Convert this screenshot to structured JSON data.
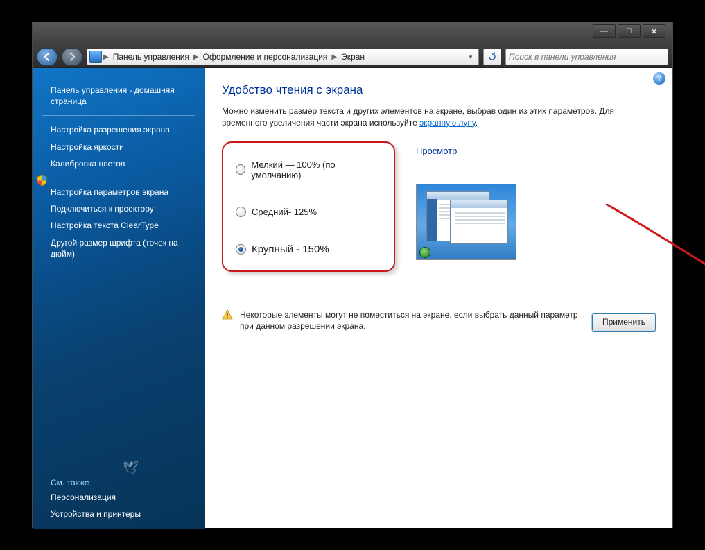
{
  "window": {
    "min": "—",
    "max": "□",
    "close": "✕"
  },
  "nav": {
    "breadcrumb": [
      "Панель управления",
      "Оформление и персонализация",
      "Экран"
    ],
    "search_placeholder": "Поиск в панели управления"
  },
  "sidebar": {
    "home": "Панель управления - домашняя страница",
    "items": [
      "Настройка разрешения экрана",
      "Настройка яркости",
      "Калибровка цветов",
      "Настройка параметров экрана",
      "Подключиться к проектору",
      "Настройка текста ClearType",
      "Другой размер шрифта (точек на дюйм)"
    ],
    "shield_index": 2,
    "see_also_title": "См. также",
    "see_also": [
      "Персонализация",
      "Устройства и принтеры"
    ]
  },
  "page": {
    "title": "Удобство чтения с экрана",
    "intro_1": "Можно изменить размер текста и других элементов на экране, выбрав один из этих параметров. Для временного увеличения части экрана используйте ",
    "intro_link": "экранную лупу",
    "intro_2": ".",
    "options": [
      {
        "label": "Мелкий — 100% (по умолчанию)",
        "checked": false,
        "large": false
      },
      {
        "label": "Средний- 125%",
        "checked": false,
        "large": false
      },
      {
        "label": "Крупный - 150%",
        "checked": true,
        "large": true
      }
    ],
    "preview_label": "Просмотр",
    "warning": "Некоторые элементы могут не поместиться на экране, если выбрать данный параметр при данном разрешении экрана.",
    "apply": "Применить"
  }
}
